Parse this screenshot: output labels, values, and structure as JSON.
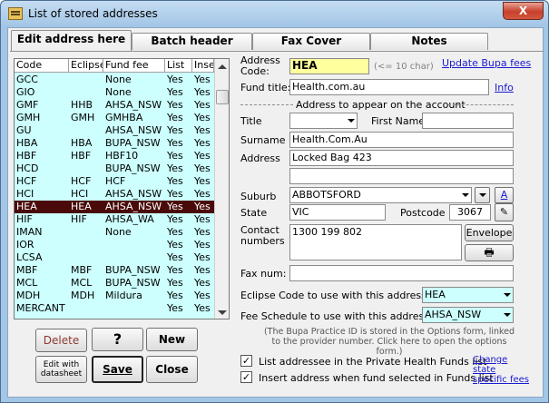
{
  "window": {
    "title": "List of stored addresses",
    "close_glyph": "X"
  },
  "tabs": [
    {
      "label": "Edit address here",
      "active": true
    },
    {
      "label": "Batch header",
      "active": false
    },
    {
      "label": "Fax Cover",
      "active": false
    },
    {
      "label": "Notes",
      "active": false
    }
  ],
  "list": {
    "headers": [
      "Code",
      "Eclipse",
      "Fund fee",
      "List",
      "Inser"
    ],
    "rows": [
      [
        "GCC",
        "",
        "None",
        "Yes",
        "Yes"
      ],
      [
        "GIO",
        "",
        "None",
        "Yes",
        "Yes"
      ],
      [
        "GMF",
        "HHB",
        "AHSA_NSW",
        "Yes",
        "Yes"
      ],
      [
        "GMH",
        "GMH",
        "GMHBA",
        "Yes",
        "Yes"
      ],
      [
        "GU",
        "",
        "AHSA_NSW",
        "Yes",
        "Yes"
      ],
      [
        "HBA",
        "HBA",
        "BUPA_NSW",
        "Yes",
        "Yes"
      ],
      [
        "HBF",
        "HBF",
        "HBF10",
        "Yes",
        "Yes"
      ],
      [
        "HCD",
        "",
        "BUPA_NSW",
        "Yes",
        "Yes"
      ],
      [
        "HCF",
        "HCF",
        "HCF",
        "Yes",
        "Yes"
      ],
      [
        "HCI",
        "HCI",
        "AHSA_NSW",
        "Yes",
        "Yes"
      ],
      [
        "HEA",
        "HEA",
        "AHSA_NSW",
        "Yes",
        "Yes"
      ],
      [
        "HIF",
        "HIF",
        "AHSA_WA",
        "Yes",
        "Yes"
      ],
      [
        "IMAN",
        "",
        "None",
        "Yes",
        "Yes"
      ],
      [
        "IOR",
        "",
        "",
        "Yes",
        "Yes"
      ],
      [
        "LCSA",
        "",
        "",
        "Yes",
        "Yes"
      ],
      [
        "MBF",
        "MBF",
        "BUPA_NSW",
        "Yes",
        "Yes"
      ],
      [
        "MCL",
        "MCL",
        "BUPA_NSW",
        "Yes",
        "Yes"
      ],
      [
        "MDH",
        "MDH",
        "Mildura",
        "Yes",
        "Yes"
      ],
      [
        "MERCANT",
        "",
        "",
        "Yes",
        "Yes"
      ]
    ],
    "selected_index": 10
  },
  "buttons": {
    "delete": "Delete",
    "help": "?",
    "new": "New",
    "edit_datasheet": "Edit with datasheet",
    "save": "Save",
    "close": "Close"
  },
  "form": {
    "address_code_label": "Address Code:",
    "address_code_value": "HEA",
    "address_code_hint": "(<= 10 char)",
    "update_link": "Update Bupa fees",
    "fund_title_label": "Fund title:",
    "fund_title_value": "Health.com.au",
    "info_link": "Info",
    "section_heading": "Address to appear on the account",
    "title_label": "Title",
    "title_value": "",
    "first_name_label": "First Name",
    "first_name_value": "",
    "surname_label": "Surname",
    "surname_value": "Health.Com.Au",
    "address_label": "Address",
    "address_line1": "Locked Bag 423",
    "address_line2": "",
    "suburb_label": "Suburb",
    "suburb_value": "ABBOTSFORD",
    "suburb_a_btn": "A",
    "state_label": "State",
    "state_value": "VIC",
    "postcode_label": "Postcode",
    "postcode_value": "3067",
    "contact_label": "Contact numbers",
    "contact_value": "1300 199 802",
    "envelope_btn": "Envelope",
    "fax_label": "Fax num:",
    "fax_value": "",
    "eclipse_label": "Eclipse Code to use with this addressee",
    "eclipse_value": "HEA",
    "fee_label": "Fee Schedule to use with this addressee",
    "fee_value": "AHSA_NSW",
    "note": "(The Bupa Practice ID is stored in the Options form, linked to the provider number. Click here to open the options form.)",
    "list_check_label": "List addressee in the Private Health Funds list",
    "insert_check_label": "Insert address when fund selected in Funds list",
    "change_link": "Change state specific fees"
  },
  "colors": {
    "list_bg": "#ccfffe",
    "selected_row_bg": "#4a0a0a",
    "code_field_bg": "#ffff9e",
    "link": "#1a1ad0",
    "window_frame": "#a3c6e6"
  }
}
